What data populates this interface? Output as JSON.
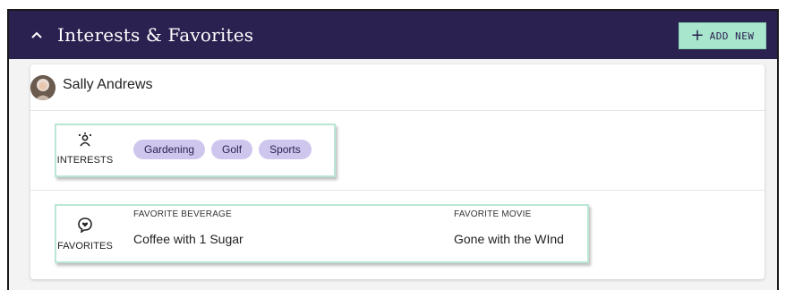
{
  "header": {
    "title": "Interests & Favorites",
    "add_button_plus": "+",
    "add_button_label": "ADD NEW"
  },
  "user": {
    "name": "Sally Andrews"
  },
  "interests": {
    "label": "INTERESTS",
    "tags": [
      "Gardening",
      "Golf",
      "Sports"
    ]
  },
  "favorites": {
    "label": "FAVORITES",
    "items": [
      {
        "label": "FAVORITE BEVERAGE",
        "value": "Coffee with 1 Sugar"
      },
      {
        "label": "FAVORITE MOVIE",
        "value": "Gone with the WInd"
      }
    ]
  },
  "colors": {
    "header_bg": "#2b2150",
    "accent_green": "#a8e6cd",
    "chip_bg": "#cfc6ee",
    "highlight_border": "#b9e7d3"
  },
  "icons": {
    "collapse": "chevron-up-icon",
    "interests": "person-sparkle-icon",
    "favorites": "heart-chat-icon"
  }
}
